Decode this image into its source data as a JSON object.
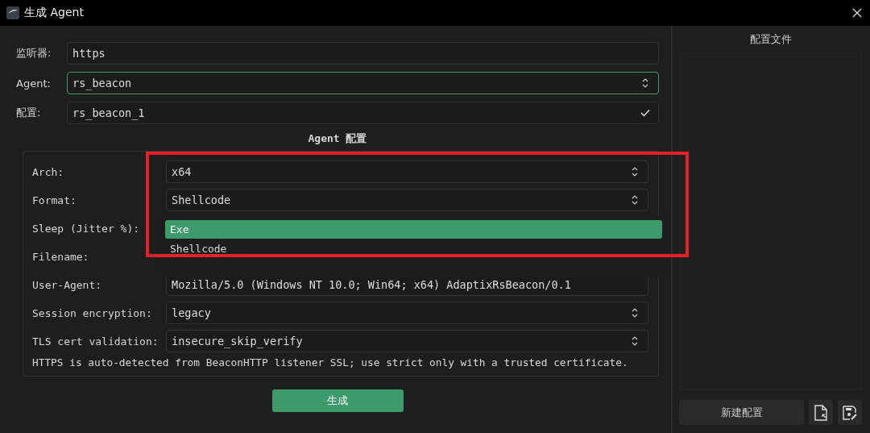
{
  "window": {
    "title": "生成 Agent"
  },
  "fields": [
    {
      "label": "监听器:",
      "value": "https",
      "kind": "text",
      "focused": false
    },
    {
      "label": "Agent:",
      "value": "rs_beacon",
      "kind": "combo",
      "focused": true
    },
    {
      "label": "配置:",
      "value": "rs_beacon_1",
      "kind": "check",
      "focused": false
    }
  ],
  "section_title": "Agent 配置",
  "agent_config": [
    {
      "label": "Arch:",
      "value": "x64",
      "kind": "combo"
    },
    {
      "label": "Format:",
      "value": "Shellcode",
      "kind": "combo"
    },
    {
      "label": "Sleep (Jitter %):"
    },
    {
      "label": "Filename:"
    },
    {
      "label": "User-Agent:",
      "value": "Mozilla/5.0 (Windows NT 10.0; Win64; x64) AdaptixRsBeacon/0.1",
      "kind": "text"
    },
    {
      "label": "Session encryption:",
      "value": "legacy",
      "kind": "combo"
    },
    {
      "label": "TLS cert validation:",
      "value": "insecure_skip_verify",
      "kind": "combo"
    }
  ],
  "format_dropdown": [
    {
      "label": "Exe",
      "selected": true
    },
    {
      "label": "Shellcode",
      "selected": false
    }
  ],
  "note": "HTTPS is auto-detected from BeaconHTTP listener SSL; use strict only with a trusted certificate.",
  "generate_button": "生成",
  "profiles": {
    "title": "配置文件",
    "new_button": "新建配置"
  }
}
